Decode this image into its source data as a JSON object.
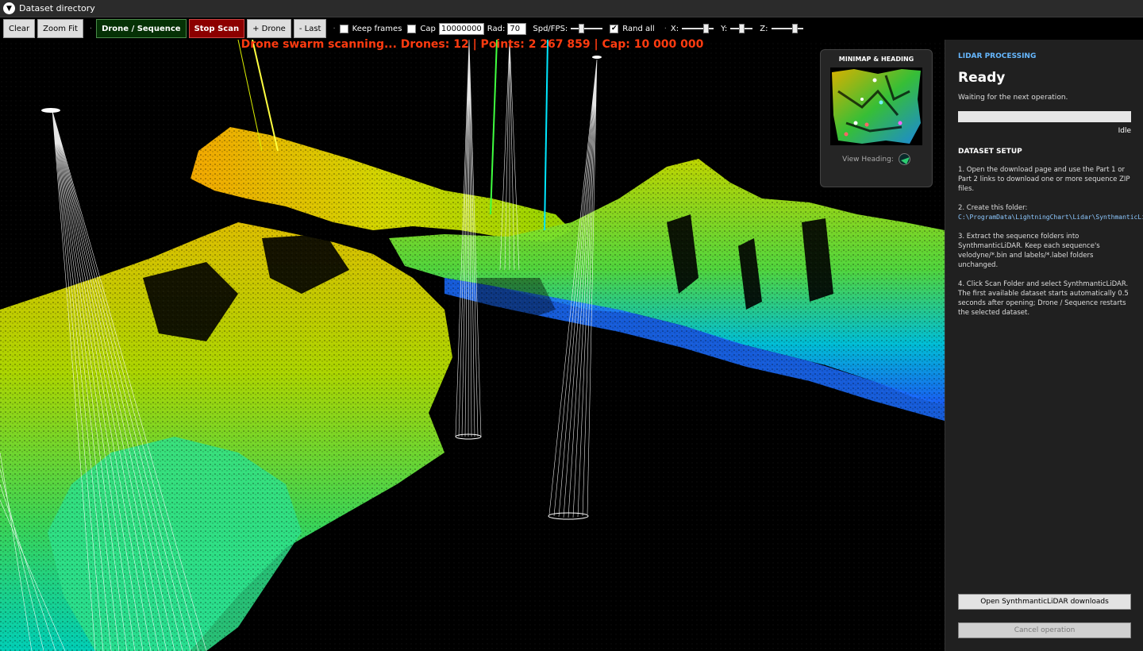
{
  "window": {
    "title": "Dataset directory"
  },
  "toolbar": {
    "clear": "Clear",
    "zoom_fit": "Zoom Fit",
    "drone_sequence": "Drone / Sequence",
    "stop_scan": "Stop Scan",
    "add_drone": "+ Drone",
    "last": "- Last",
    "keep_frames": {
      "label": "Keep frames",
      "checked": false
    },
    "cap": {
      "label": "Cap",
      "checked": false,
      "value": "10000000"
    },
    "rad": {
      "label": "Rad:",
      "value": "70"
    },
    "spd_fps": {
      "label": "Spd/FPS:",
      "level": 0.3
    },
    "rand_all": {
      "label": "Rand all",
      "checked": true
    },
    "x": {
      "label": "X:",
      "level": 0.8
    },
    "y": {
      "label": "Y:",
      "level": 0.5
    },
    "z": {
      "label": "Z:",
      "level": 0.8
    }
  },
  "viewport": {
    "status_text": "Drone swarm scanning... Drones: 12 | Points: 2 267 859 | Cap: 10 000 000",
    "status_color": "#ff3b10"
  },
  "minimap": {
    "title": "MINIMAP & HEADING",
    "heading_label": "View Heading:"
  },
  "panel": {
    "section_title": "LIDAR PROCESSING",
    "status": "Ready",
    "substatus": "Waiting for the next operation.",
    "progress": 0,
    "progress_label": "Idle",
    "setup_title": "DATASET SETUP",
    "steps": [
      "1. Open the download page and use the Part 1 or Part 2 links to download one or more sequence ZIP files.",
      "2. Create this folder:",
      "3. Extract the sequence folders into SynthmanticLiDAR. Keep each sequence's velodyne/*.bin and labels/*.label folders unchanged.",
      "4. Click Scan Folder and select SynthmanticLiDAR. The first available dataset starts automatically 0.5 seconds after opening; Drone / Sequence restarts the selected dataset."
    ],
    "folder_path": "C:\\ProgramData\\LightningChart\\Lidar\\SynthmanticLiDAR",
    "download_button": "Open SynthmanticLiDAR downloads",
    "cancel_button": "Cancel operation",
    "accent_color": "#66b8ff"
  }
}
